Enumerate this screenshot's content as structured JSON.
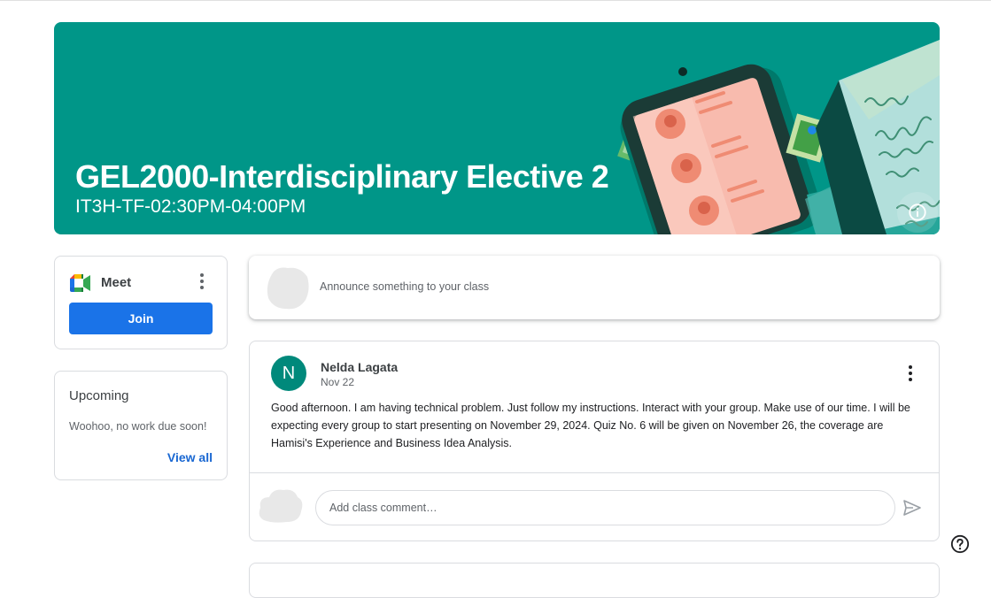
{
  "banner": {
    "title": "GEL2000-Interdisciplinary Elective 2",
    "subtitle": "IT3H-TF-02:30PM-04:00PM",
    "background_color": "#009688"
  },
  "meet": {
    "label": "Meet",
    "join_label": "Join",
    "accent_color": "#1a73e8"
  },
  "upcoming": {
    "title": "Upcoming",
    "empty_text": "Woohoo, no work due soon!",
    "view_all_label": "View all"
  },
  "announce": {
    "placeholder": "Announce something to your class"
  },
  "post": {
    "avatar_letter": "N",
    "author": "Nelda Lagata",
    "date": "Nov 22",
    "body": "Good afternoon.  I am having technical problem.  Just follow my instructions.  Interact with your group.  Make use of our time. I will be expecting every group to start presenting on November 29, 2024.  Quiz No. 6 will be given on November 26, the coverage are Hamisi's Experience and Business Idea Analysis.",
    "comment_placeholder": "Add class comment…"
  },
  "icons": {
    "info": "info-icon",
    "more": "more-vert-icon",
    "send": "send-icon",
    "help": "help-icon"
  }
}
